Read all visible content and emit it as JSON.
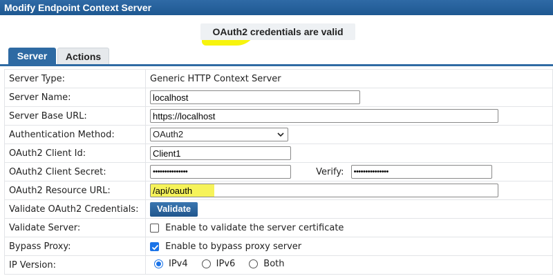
{
  "window": {
    "title": "Modify Endpoint Context Server"
  },
  "status": {
    "message": "OAuth2 credentials are valid"
  },
  "tabs": [
    {
      "label": "Server",
      "active": true
    },
    {
      "label": "Actions",
      "active": false
    }
  ],
  "form": {
    "server_type": {
      "label": "Server Type:",
      "value": "Generic HTTP Context Server"
    },
    "server_name": {
      "label": "Server Name:",
      "value": "localhost"
    },
    "base_url": {
      "label": "Server Base URL:",
      "value": "https://localhost"
    },
    "auth_method": {
      "label": "Authentication Method:",
      "value": "OAuth2"
    },
    "client_id": {
      "label": "OAuth2 Client Id:",
      "value": "Client1"
    },
    "client_secret": {
      "label": "OAuth2 Client Secret:",
      "value": "•••••••••••••••",
      "verify_label": "Verify:",
      "verify_value": "•••••••••••••••"
    },
    "resource_url": {
      "label": "OAuth2 Resource URL:",
      "value": "/api/oauth"
    },
    "validate_creds": {
      "label": "Validate OAuth2 Credentials:",
      "button": "Validate"
    },
    "validate_server": {
      "label": "Validate Server:",
      "checked": false,
      "text": "Enable to validate the server certificate"
    },
    "bypass_proxy": {
      "label": "Bypass Proxy:",
      "checked": true,
      "text": "Enable to bypass proxy server"
    },
    "ip_version": {
      "label": "IP Version:",
      "options": [
        "IPv4",
        "IPv6",
        "Both"
      ],
      "selected": "IPv4"
    }
  },
  "colors": {
    "accent": "#2e6aa3",
    "highlight": "#f7f300",
    "check": "#1a73e8"
  }
}
